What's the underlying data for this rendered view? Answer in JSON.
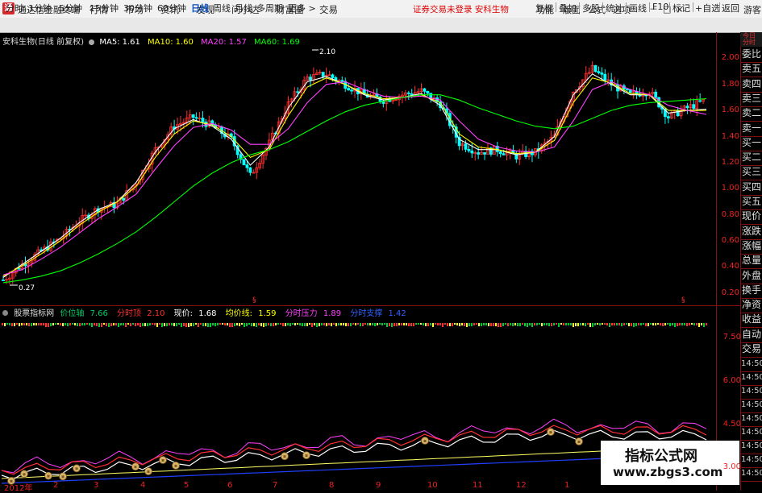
{
  "app": {
    "title": "通达信金融终端",
    "logo_text": "通"
  },
  "menu": [
    "行情",
    "市场",
    "资讯",
    "发现",
    "问小达",
    "财富圈",
    "交易"
  ],
  "banner": {
    "text": "证券交易未登录  安科生物",
    "color": "#dd0000"
  },
  "right_menu": [
    "功能",
    "版面",
    "公式",
    "选项"
  ],
  "window_controls": "－□×",
  "guest": "游客",
  "periods": {
    "items": [
      "分时",
      "1分钟",
      "5分钟",
      "15分钟",
      "30分钟",
      "60分钟",
      "日线",
      "周线",
      "月线",
      "多周期",
      "更多 >"
    ],
    "active": "日线"
  },
  "toolbar_right": [
    "复权",
    "叠加",
    "多股",
    "统计",
    "画线",
    "F10",
    "标记",
    "+自选",
    "返回"
  ],
  "chart_info": {
    "stock": "安科生物(日线 前复权)",
    "ma": [
      {
        "label": "MA5:",
        "value": "1.61",
        "color": "#ffffff"
      },
      {
        "label": "MA10:",
        "value": "1.60",
        "color": "#ffff00"
      },
      {
        "label": "MA20:",
        "value": "1.57",
        "color": "#ff40ff"
      },
      {
        "label": "MA60:",
        "value": "1.69",
        "color": "#00ff00"
      }
    ]
  },
  "price_annotations": {
    "high": "2.10",
    "low": "0.27"
  },
  "main_axis": [
    "2.00",
    "1.80",
    "1.60",
    "1.40",
    "1.20",
    "1.00",
    "0.80",
    "0.60",
    "0.40",
    "0.20"
  ],
  "indicator": {
    "name": "股票指标网",
    "items": [
      {
        "label": "价位轴",
        "value": "7.66",
        "color": "#00cc66"
      },
      {
        "label": "分时顶",
        "value": "2.10",
        "color": "#ff3030"
      },
      {
        "label": "现价:",
        "value": "1.68",
        "color": "#ffffff"
      },
      {
        "label": "均价线:",
        "value": "1.59",
        "color": "#ffff00"
      },
      {
        "label": "分时压力",
        "value": "1.89",
        "color": "#ff40ff"
      },
      {
        "label": "分时支撑",
        "value": "1.42",
        "color": "#3060ff"
      }
    ]
  },
  "sub_axis": [
    "7.50",
    "6.00",
    "4.50",
    "3.00"
  ],
  "x_axis": [
    "2012年",
    "2",
    "3",
    "4",
    "5",
    "6",
    "7",
    "8",
    "9",
    "10",
    "11",
    "12",
    "1"
  ],
  "right_panel": {
    "top": "今日分时",
    "items": [
      "委比",
      "卖五",
      "卖四",
      "卖三",
      "卖二",
      "卖一",
      "买一",
      "买二",
      "买三",
      "买四",
      "买五",
      "现价",
      "涨跌",
      "涨幅",
      "总量",
      "外盘",
      "换手",
      "净资",
      "收益",
      "自动",
      "交易",
      "14:50",
      "14:50",
      "14:50",
      "14:50",
      "14:50",
      "14:50",
      "14:50",
      "14:50",
      "14:50"
    ]
  },
  "watermark": {
    "line1": "指标公式网",
    "line2": "www.zbgs3.com"
  },
  "colors": {
    "up": "#ff3030",
    "down": "#00ffff",
    "ma5": "#ffffff",
    "ma10": "#ffff00",
    "ma20": "#ff40ff",
    "ma60": "#00ff00"
  },
  "chart_data": {
    "type": "line",
    "title": "安科生物(日线 前复权)",
    "ylim": [
      0.2,
      2.1
    ],
    "x": [
      "2012年",
      "2",
      "3",
      "4",
      "5",
      "6",
      "7",
      "8",
      "9",
      "10",
      "11",
      "12",
      "1"
    ],
    "close": [
      0.3,
      0.42,
      0.52,
      0.62,
      0.75,
      0.85,
      0.88,
      1.05,
      1.3,
      1.48,
      1.55,
      1.48,
      1.38,
      1.1,
      1.35,
      1.65,
      1.85,
      1.88,
      1.8,
      1.72,
      1.68,
      1.72,
      1.75,
      1.65,
      1.35,
      1.28,
      1.3,
      1.25,
      1.28,
      1.4,
      1.75,
      1.92,
      1.8,
      1.72,
      1.75,
      1.55,
      1.62,
      1.68
    ],
    "series": [
      {
        "name": "MA5",
        "values": [
          0.32,
          0.42,
          0.52,
          0.62,
          0.74,
          0.84,
          0.9,
          1.05,
          1.28,
          1.46,
          1.53,
          1.48,
          1.38,
          1.18,
          1.32,
          1.62,
          1.82,
          1.86,
          1.8,
          1.72,
          1.68,
          1.7,
          1.73,
          1.64,
          1.38,
          1.3,
          1.3,
          1.26,
          1.28,
          1.4,
          1.72,
          1.88,
          1.8,
          1.72,
          1.72,
          1.58,
          1.6,
          1.61
        ]
      },
      {
        "name": "MA10",
        "values": [
          0.33,
          0.41,
          0.5,
          0.6,
          0.72,
          0.82,
          0.9,
          1.02,
          1.24,
          1.42,
          1.52,
          1.49,
          1.4,
          1.24,
          1.3,
          1.56,
          1.78,
          1.85,
          1.8,
          1.73,
          1.69,
          1.7,
          1.72,
          1.66,
          1.42,
          1.32,
          1.3,
          1.27,
          1.28,
          1.37,
          1.66,
          1.85,
          1.81,
          1.73,
          1.72,
          1.6,
          1.6,
          1.6
        ]
      },
      {
        "name": "MA20",
        "values": [
          0.34,
          0.38,
          0.46,
          0.55,
          0.66,
          0.77,
          0.86,
          0.96,
          1.15,
          1.33,
          1.47,
          1.5,
          1.45,
          1.34,
          1.34,
          1.46,
          1.66,
          1.8,
          1.82,
          1.76,
          1.71,
          1.7,
          1.71,
          1.68,
          1.52,
          1.38,
          1.32,
          1.29,
          1.28,
          1.32,
          1.52,
          1.76,
          1.82,
          1.76,
          1.72,
          1.64,
          1.6,
          1.57
        ]
      },
      {
        "name": "MA60",
        "values": [
          0.28,
          0.3,
          0.33,
          0.37,
          0.43,
          0.5,
          0.58,
          0.67,
          0.78,
          0.9,
          1.02,
          1.12,
          1.2,
          1.26,
          1.3,
          1.36,
          1.44,
          1.52,
          1.59,
          1.64,
          1.67,
          1.7,
          1.72,
          1.72,
          1.68,
          1.62,
          1.57,
          1.52,
          1.48,
          1.46,
          1.48,
          1.54,
          1.6,
          1.64,
          1.66,
          1.67,
          1.68,
          1.69
        ]
      }
    ]
  }
}
